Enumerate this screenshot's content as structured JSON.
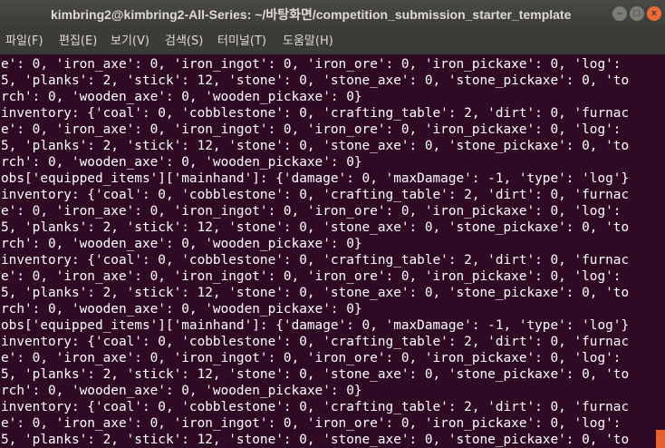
{
  "window": {
    "title": "kimbring2@kimbring2-All-Series: ~/바탕화면/competition_submission_starter_template",
    "min_glyph": "–",
    "max_glyph": "□",
    "close_glyph": "×"
  },
  "menu": {
    "items": [
      "파일(F)",
      "편집(E)",
      "보기(V)",
      "검색(S)",
      "터미널(T)",
      "도움말(H)"
    ]
  },
  "terminal": {
    "lines": [
      "e': 0, 'iron_axe': 0, 'iron_ingot': 0, 'iron_ore': 0, 'iron_pickaxe': 0, 'log':",
      "5, 'planks': 2, 'stick': 12, 'stone': 0, 'stone_axe': 0, 'stone_pickaxe': 0, 'to",
      "rch': 0, 'wooden_axe': 0, 'wooden_pickaxe': 0}",
      "inventory: {'coal': 0, 'cobblestone': 0, 'crafting_table': 2, 'dirt': 0, 'furnac",
      "e': 0, 'iron_axe': 0, 'iron_ingot': 0, 'iron_ore': 0, 'iron_pickaxe': 0, 'log':",
      "5, 'planks': 2, 'stick': 12, 'stone': 0, 'stone_axe': 0, 'stone_pickaxe': 0, 'to",
      "rch': 0, 'wooden_axe': 0, 'wooden_pickaxe': 0}",
      "obs['equipped_items']['mainhand']: {'damage': 0, 'maxDamage': -1, 'type': 'log'}",
      "inventory: {'coal': 0, 'cobblestone': 0, 'crafting_table': 2, 'dirt': 0, 'furnac",
      "e': 0, 'iron_axe': 0, 'iron_ingot': 0, 'iron_ore': 0, 'iron_pickaxe': 0, 'log':",
      "5, 'planks': 2, 'stick': 12, 'stone': 0, 'stone_axe': 0, 'stone_pickaxe': 0, 'to",
      "rch': 0, 'wooden_axe': 0, 'wooden_pickaxe': 0}",
      "inventory: {'coal': 0, 'cobblestone': 0, 'crafting_table': 2, 'dirt': 0, 'furnac",
      "e': 0, 'iron_axe': 0, 'iron_ingot': 0, 'iron_ore': 0, 'iron_pickaxe': 0, 'log':",
      "5, 'planks': 2, 'stick': 12, 'stone': 0, 'stone_axe': 0, 'stone_pickaxe': 0, 'to",
      "rch': 0, 'wooden_axe': 0, 'wooden_pickaxe': 0}",
      "obs['equipped_items']['mainhand']: {'damage': 0, 'maxDamage': -1, 'type': 'log'}",
      "inventory: {'coal': 0, 'cobblestone': 0, 'crafting_table': 2, 'dirt': 0, 'furnac",
      "e': 0, 'iron_axe': 0, 'iron_ingot': 0, 'iron_ore': 0, 'iron_pickaxe': 0, 'log':",
      "5, 'planks': 2, 'stick': 12, 'stone': 0, 'stone_axe': 0, 'stone_pickaxe': 0, 'to",
      "rch': 0, 'wooden_axe': 0, 'wooden_pickaxe': 0}",
      "inventory: {'coal': 0, 'cobblestone': 0, 'crafting_table': 2, 'dirt': 0, 'furnac",
      "e': 0, 'iron_axe': 0, 'iron_ingot': 0, 'iron_ore': 0, 'iron_pickaxe': 0, 'log':",
      "5, 'planks': 2, 'stick': 12, 'stone': 0, 'stone_axe': 0, 'stone_pickaxe': 0, 'to"
    ]
  }
}
